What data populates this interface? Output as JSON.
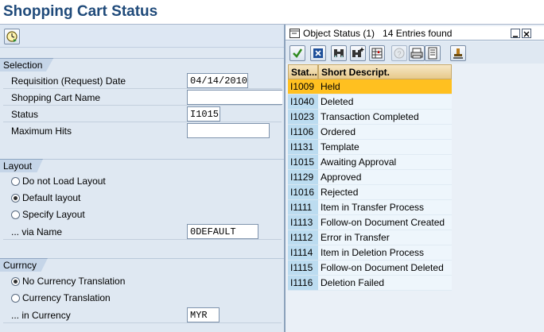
{
  "app": {
    "title": "Shopping Cart Status"
  },
  "selection": {
    "group_title": "Selection",
    "requisition_date_label": "Requisition (Request) Date",
    "requisition_date_value": "04/14/2010",
    "cart_name_label": "Shopping Cart Name",
    "cart_name_value": "",
    "status_label": "Status",
    "status_value": "I1015",
    "max_hits_label": "Maximum Hits",
    "max_hits_value": ""
  },
  "layout": {
    "group_title": "Layout",
    "options": [
      {
        "label": "Do not Load Layout",
        "selected": false
      },
      {
        "label": "Default layout",
        "selected": true
      },
      {
        "label": "Specify Layout",
        "selected": false
      }
    ],
    "via_name_label": "... via Name",
    "via_name_value": "0DEFAULT"
  },
  "currency": {
    "group_title": "Currncy",
    "options": [
      {
        "label": "No Currency Translation",
        "selected": true
      },
      {
        "label": "Currency Translation",
        "selected": false
      }
    ],
    "in_currency_label": "... in Currency",
    "in_currency_value": "MYR"
  },
  "popup": {
    "title": "Object Status (1)   14 Entries found",
    "columns": {
      "status": "Stat...",
      "description": "Short Descript."
    },
    "rows": [
      {
        "id": "I1009",
        "desc": "Held",
        "selected": true
      },
      {
        "id": "I1040",
        "desc": "Deleted"
      },
      {
        "id": "I1023",
        "desc": "Transaction Completed"
      },
      {
        "id": "I1106",
        "desc": "Ordered"
      },
      {
        "id": "I1131",
        "desc": "Template"
      },
      {
        "id": "I1015",
        "desc": "Awaiting Approval"
      },
      {
        "id": "I1129",
        "desc": "Approved"
      },
      {
        "id": "I1016",
        "desc": "Rejected"
      },
      {
        "id": "I1111",
        "desc": "Item in Transfer Process"
      },
      {
        "id": "I1113",
        "desc": "Follow-on Document Created"
      },
      {
        "id": "I1112",
        "desc": "Error in Transfer"
      },
      {
        "id": "I1114",
        "desc": "Item in Deletion Process"
      },
      {
        "id": "I1115",
        "desc": "Follow-on Document Deleted"
      },
      {
        "id": "I1116",
        "desc": "Deletion Failed"
      }
    ]
  }
}
